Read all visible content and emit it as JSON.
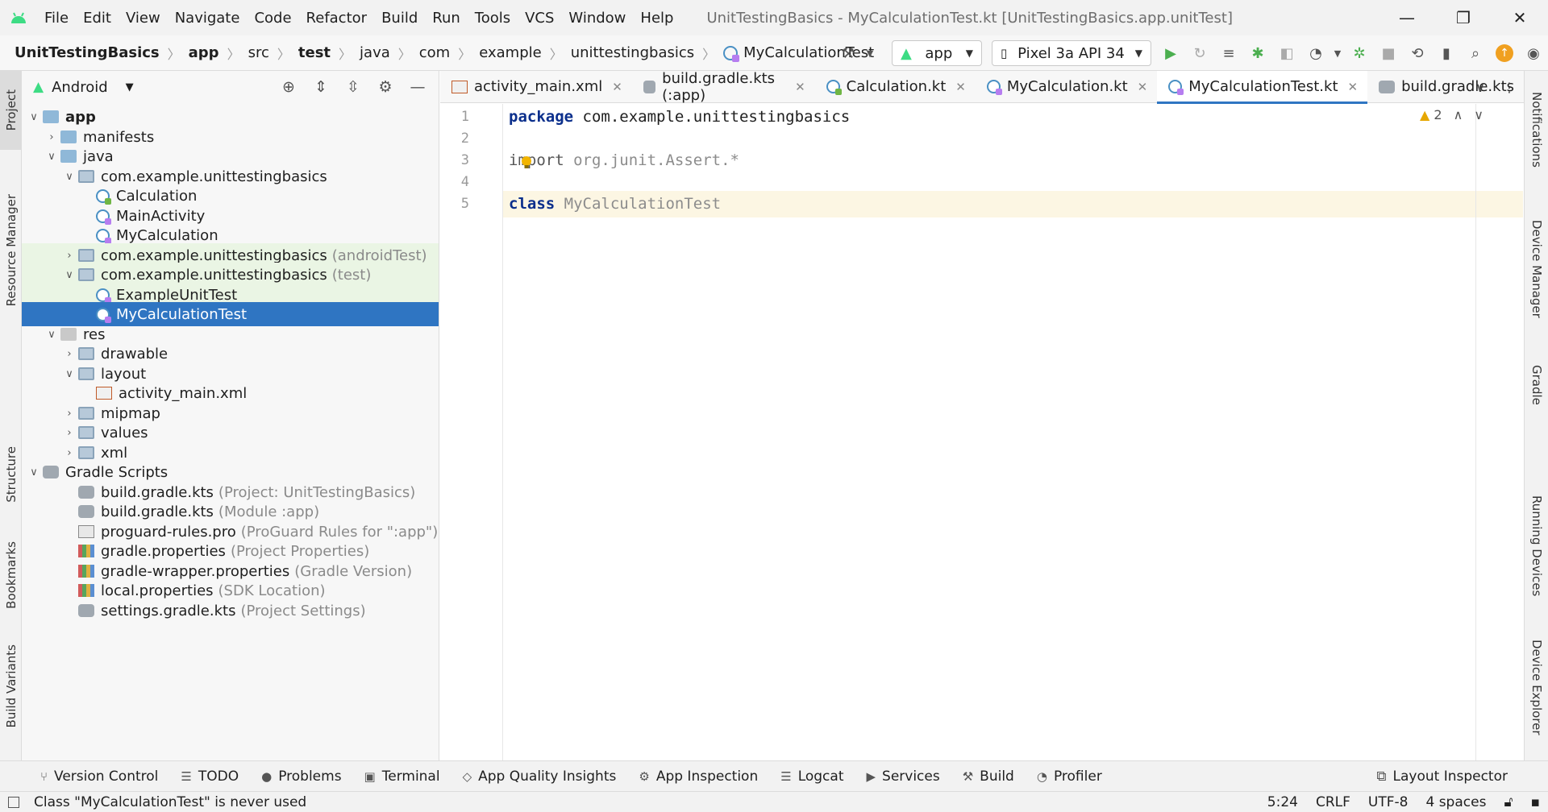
{
  "window": {
    "title": "UnitTestingBasics - MyCalculationTest.kt [UnitTestingBasics.app.unitTest]",
    "controls": [
      "—",
      "❐",
      "✕"
    ]
  },
  "menu": [
    "File",
    "Edit",
    "View",
    "Navigate",
    "Code",
    "Refactor",
    "Build",
    "Run",
    "Tools",
    "VCS",
    "Window",
    "Help"
  ],
  "breadcrumb": [
    "UnitTestingBasics",
    "app",
    "src",
    "test",
    "java",
    "com",
    "example",
    "unittestingbasics",
    "MyCalculationTest"
  ],
  "toolbar": {
    "config": "app",
    "device": "Pixel 3a API 34"
  },
  "left_strip": [
    "Project",
    "Resource Manager",
    "Structure",
    "Bookmarks",
    "Build Variants"
  ],
  "right_strip": [
    "Notifications",
    "Device Manager",
    "Gradle",
    "Running Devices",
    "Device Explorer"
  ],
  "project": {
    "view": "Android",
    "tree": [
      {
        "label": "app",
        "hint": ""
      },
      {
        "label": "manifests",
        "hint": ""
      },
      {
        "label": "java",
        "hint": ""
      },
      {
        "label": "com.example.unittestingbasics",
        "hint": ""
      },
      {
        "label": "Calculation",
        "hint": ""
      },
      {
        "label": "MainActivity",
        "hint": ""
      },
      {
        "label": "MyCalculation",
        "hint": ""
      },
      {
        "label": "com.example.unittestingbasics",
        "hint": "(androidTest)"
      },
      {
        "label": "com.example.unittestingbasics",
        "hint": "(test)"
      },
      {
        "label": "ExampleUnitTest",
        "hint": ""
      },
      {
        "label": "MyCalculationTest",
        "hint": ""
      },
      {
        "label": "res",
        "hint": ""
      },
      {
        "label": "drawable",
        "hint": ""
      },
      {
        "label": "layout",
        "hint": ""
      },
      {
        "label": "activity_main.xml",
        "hint": ""
      },
      {
        "label": "mipmap",
        "hint": ""
      },
      {
        "label": "values",
        "hint": ""
      },
      {
        "label": "xml",
        "hint": ""
      },
      {
        "label": "Gradle Scripts",
        "hint": ""
      },
      {
        "label": "build.gradle.kts",
        "hint": "(Project: UnitTestingBasics)"
      },
      {
        "label": "build.gradle.kts",
        "hint": "(Module :app)"
      },
      {
        "label": "proguard-rules.pro",
        "hint": "(ProGuard Rules for \":app\")"
      },
      {
        "label": "gradle.properties",
        "hint": "(Project Properties)"
      },
      {
        "label": "gradle-wrapper.properties",
        "hint": "(Gradle Version)"
      },
      {
        "label": "local.properties",
        "hint": "(SDK Location)"
      },
      {
        "label": "settings.gradle.kts",
        "hint": "(Project Settings)"
      }
    ]
  },
  "tabs": [
    "activity_main.xml",
    "build.gradle.kts (:app)",
    "Calculation.kt",
    "MyCalculation.kt",
    "MyCalculationTest.kt",
    "build.gradle.kts"
  ],
  "editor": {
    "line_numbers": [
      "1",
      "2",
      "3",
      "4",
      "5"
    ],
    "line1_kw": "package",
    "line1_rest": " com.example.unittestingbasics",
    "line3_kw": "import",
    "line3_rest": " org.junit.Assert.*",
    "line5_kw": "class",
    "line5_rest": " MyCalculationTest",
    "warning_count": "2"
  },
  "bottom_tools": [
    "Version Control",
    "TODO",
    "Problems",
    "Terminal",
    "App Quality Insights",
    "App Inspection",
    "Logcat",
    "Services",
    "Build",
    "Profiler"
  ],
  "layout_inspector": "Layout Inspector",
  "status": {
    "message": "Class \"MyCalculationTest\" is never used",
    "position": "5:24",
    "line_sep": "CRLF",
    "encoding": "UTF-8",
    "indent": "4 spaces"
  }
}
